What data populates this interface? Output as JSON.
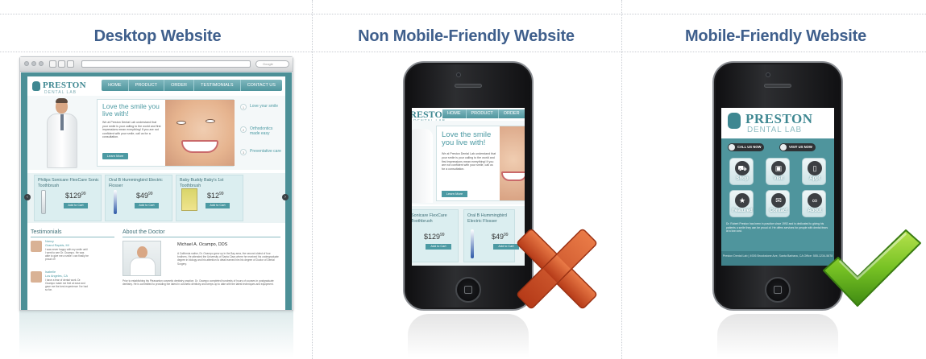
{
  "columns": [
    {
      "title": "Desktop Website"
    },
    {
      "title": "Non Mobile-Friendly Website"
    },
    {
      "title": "Mobile-Friendly Website"
    }
  ],
  "colors": {
    "title": "#3f5f8c",
    "teal": "#4c9097",
    "x_mark": "#d9532b",
    "check_mark": "#66b51c"
  },
  "desktop": {
    "search_placeholder": "Google",
    "logo": {
      "main": "PRESTON",
      "sub": "DENTAL LAB"
    },
    "nav": [
      "HOME",
      "PRODUCT",
      "ORDER",
      "TESTIMONIALS",
      "CONTACT US"
    ],
    "hero": {
      "title": "Love the smile you live with!",
      "copy": "We at Preston Dental Lab understand that your smile is your calling to the world and first impressions mean everything! If you are not confident with your smile, call us for a consultation.",
      "button": "Learn More"
    },
    "side_items": [
      {
        "num": "1",
        "label": "Love your smile"
      },
      {
        "num": "2",
        "label": "Orthodontics made easy"
      },
      {
        "num": "3",
        "label": "Preventative care"
      }
    ],
    "products": [
      {
        "name": "Philips Sonicare FlexCare Sonic Toothbrush",
        "price": "$129",
        "cents": "99",
        "button": "Add to Cart"
      },
      {
        "name": "Oral B Hummingbird Electric Flosser",
        "price": "$49",
        "cents": "99",
        "button": "Add to Cart"
      },
      {
        "name": "Baby Buddy Baby's 1st Toothbrush",
        "price": "$12",
        "cents": "99",
        "button": "Add to Cart"
      }
    ],
    "testimonials_heading": "Testimonials",
    "testimonials": [
      {
        "name": "Nancy",
        "city": "Grand Rapids, MI",
        "text": "I was never happy with my smile until I went to see Dr. Ocampo. He was able to give me a smile I can finally be proud of!"
      },
      {
        "name": "Isabelle",
        "city": "Los Angeles, CA",
        "text": "I have a fear of dental work. Dr. Ocampo made me feel at ease and gave me the best experience I've had so far."
      }
    ],
    "about_heading": "About the Doctor",
    "about_name": "Michael A. Ocampo, DDS",
    "about_copy": "A California native, Dr. Ocampo grew up in the Bay area, the second oldest of four brothers. He attended the University of Santa Clara where he received his undergraduate degree in biology and his attention to detail earned him his degree of Doctor of Dental Surgery.",
    "about_long": "Prior to establishing his Pleasanton cosmetic dentistry practice, Dr. Ocampo completed hundreds of hours of courses in postgraduate dentistry. He is committed to providing the latest in cosmetic dentistry and keeps up to date with the latest techniques and equipment."
  },
  "non_mobile": {
    "logo": {
      "main": "PRESTON",
      "sub": "DENTAL LAB"
    },
    "nav": [
      "HOME",
      "PRODUCT",
      "ORDER"
    ],
    "hero": {
      "title": "Love the smile you live with!",
      "copy": "We at Preston Dental Lab understand that your smile is your calling to the world and first impressions mean everything! If you are not confident with your smile, call us for a consultation.",
      "button": "Learn More"
    },
    "products": [
      {
        "name": "Sonicare FlexCare Toothbrush",
        "price": "$129",
        "cents": "99",
        "button": "Add to Cart"
      },
      {
        "name": "Oral B Hummingbird Electric Flosser",
        "price": "$49",
        "cents": "99",
        "button": "Add to Cart"
      }
    ]
  },
  "mobile": {
    "logo": {
      "main": "PRESTON",
      "sub": "DENTAL LAB"
    },
    "call_button": "CALL US NOW",
    "visit_button": "VISIT US NOW",
    "tiles": [
      {
        "label": "Shop",
        "icon": "cart-icon"
      },
      {
        "label": "Visit",
        "icon": "building-icon"
      },
      {
        "label": "Appt",
        "icon": "phone-icon"
      },
      {
        "label": "Featured",
        "icon": "star-icon"
      },
      {
        "label": "Contact",
        "icon": "mail-icon"
      },
      {
        "label": "About",
        "icon": "glasses-icon"
      }
    ],
    "paragraph": "Dr. Robert Preston has been in practice since 1992 and is dedicated to giving his patients a smile they can be proud of. He offers services for people with dental fears at a low cost.",
    "footer": "Preston Dental Lab | 4926 Brookstone Ave, Santa Barbara, CA Office: 555-1234-5678"
  }
}
